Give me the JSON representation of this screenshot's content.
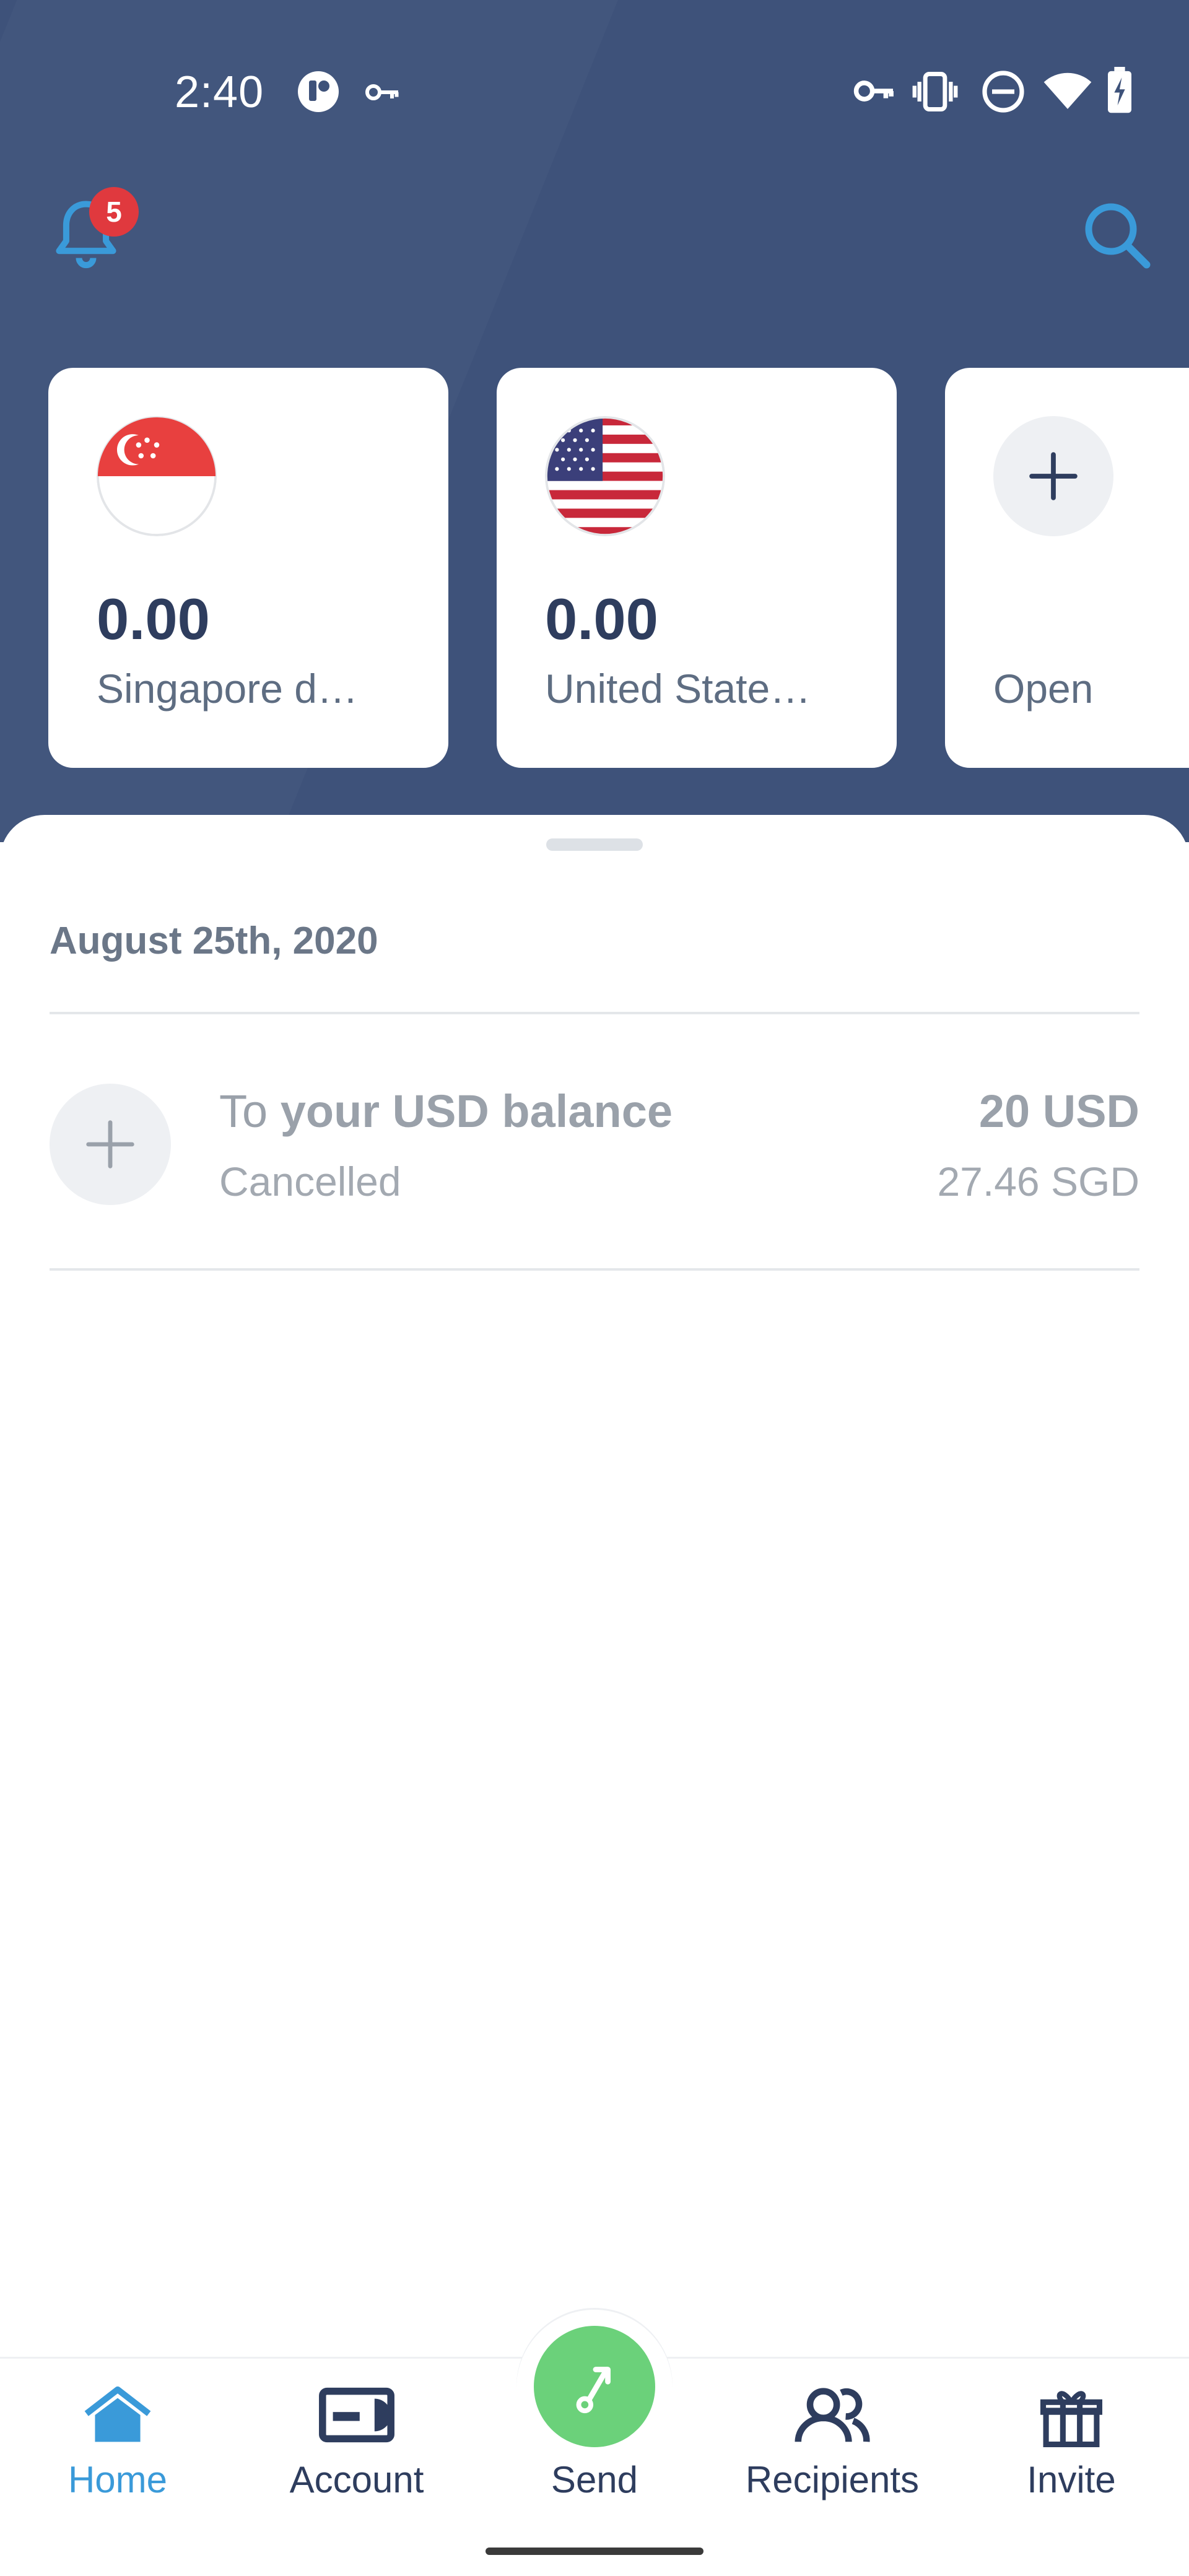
{
  "status_bar": {
    "time": "2:40",
    "icons": [
      "app-notification-icon",
      "vpn-key-icon",
      "key-icon",
      "vibrate-icon",
      "do-not-disturb-icon",
      "wifi-icon",
      "battery-charging-icon"
    ]
  },
  "header": {
    "notification_count": "5",
    "icons": [
      "bell-icon",
      "search-icon"
    ]
  },
  "balances": [
    {
      "amount": "0.00",
      "currency_name": "Singapore d…",
      "flag": "singapore-flag-icon"
    },
    {
      "amount": "0.00",
      "currency_name": "United State…",
      "flag": "us-flag-icon"
    },
    {
      "label": "Open",
      "icon": "plus-icon"
    }
  ],
  "activity": {
    "date": "August 25th, 2020",
    "transactions": [
      {
        "title_prefix": "To ",
        "title_bold": "your USD balance",
        "status": "Cancelled",
        "amount": "20 USD",
        "converted": "27.46 SGD",
        "icon": "plus-icon"
      }
    ]
  },
  "nav": {
    "items": [
      {
        "label": "Home",
        "icon": "home-icon",
        "active": true
      },
      {
        "label": "Account",
        "icon": "card-icon"
      },
      {
        "label": "Send",
        "icon": "send-arrow-icon"
      },
      {
        "label": "Recipients",
        "icon": "people-icon"
      },
      {
        "label": "Invite",
        "icon": "gift-icon"
      }
    ]
  },
  "colors": {
    "header_bg": "#3e527a",
    "accent_blue": "#3a9ad9",
    "send_green": "#6bd17a",
    "badge_red": "#e0393e",
    "text_dark": "#2e3d5e"
  }
}
